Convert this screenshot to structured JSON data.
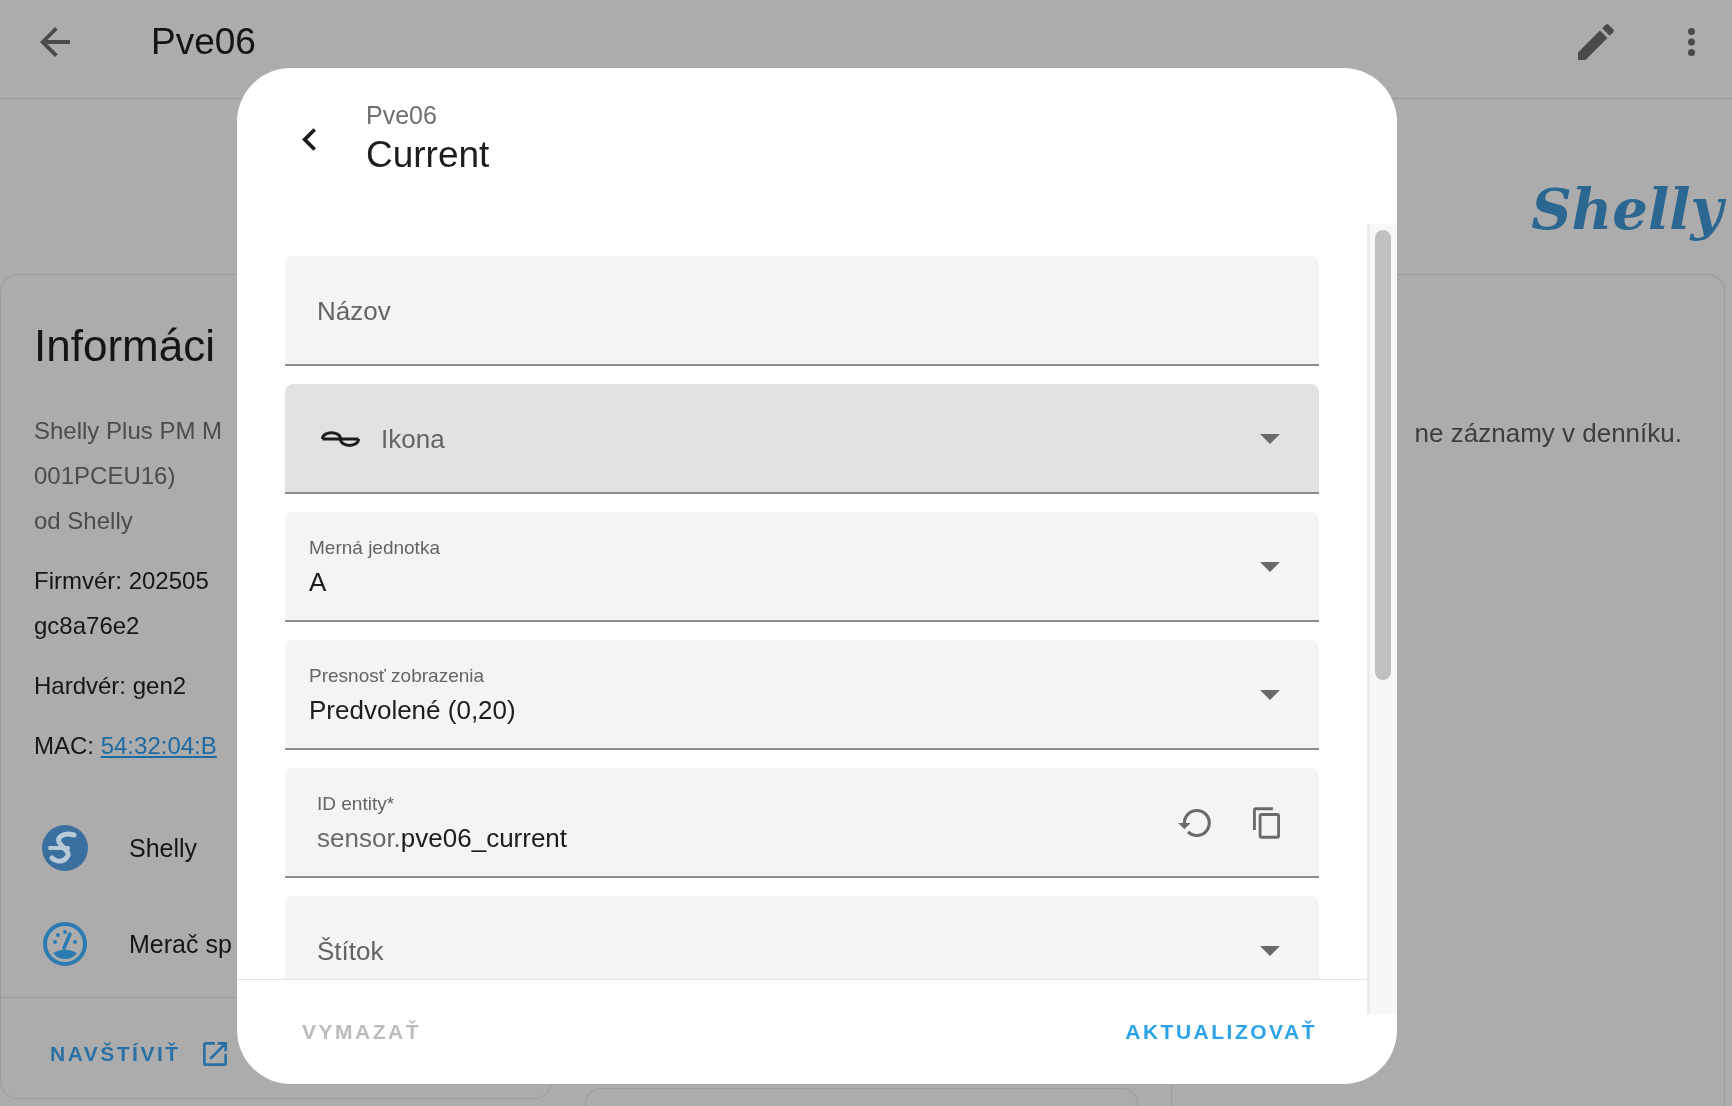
{
  "app_bar": {
    "title": "Pve06"
  },
  "info_card": {
    "title": "Informáci",
    "model_lines": [
      "Shelly Plus PM M",
      "001PCEU16)",
      "od Shelly"
    ],
    "firmware_lines": [
      "Firmvér: 202505",
      "gc8a76e2"
    ],
    "hardware": "Hardvér: gen2",
    "mac": {
      "label": "MAC:",
      "value": "54:32:04:B"
    },
    "links": [
      {
        "kind": "integration",
        "label": "Shelly"
      },
      {
        "kind": "meter",
        "label": "Merač sp"
      }
    ],
    "action": "NAVŠTÍVIŤ"
  },
  "logo": "Shelly",
  "logbook_card": {
    "message": "ne záznamy v denníku."
  },
  "dialog": {
    "subtitle": "Pve06",
    "title": "Current",
    "fields": [
      {
        "kind": "text",
        "label": "Názov",
        "hovered": false
      },
      {
        "kind": "icon-picker",
        "label": "Ikona",
        "hovered": true
      },
      {
        "kind": "select",
        "label": "Merná jednotka",
        "value": "A",
        "hovered": false
      },
      {
        "kind": "select",
        "label": "Presnosť zobrazenia",
        "value": "Predvolené (0,20)",
        "hovered": false
      },
      {
        "kind": "entity-id",
        "label": "ID entity*",
        "prefix": "sensor.",
        "value": "pve06_current",
        "hovered": false
      },
      {
        "kind": "select",
        "label": "Štítok",
        "hovered": false
      }
    ],
    "buttons": [
      {
        "label": "VYMAZAŤ",
        "disabled": true
      },
      {
        "label": "AKTUALIZOVAŤ",
        "disabled": false
      }
    ]
  }
}
